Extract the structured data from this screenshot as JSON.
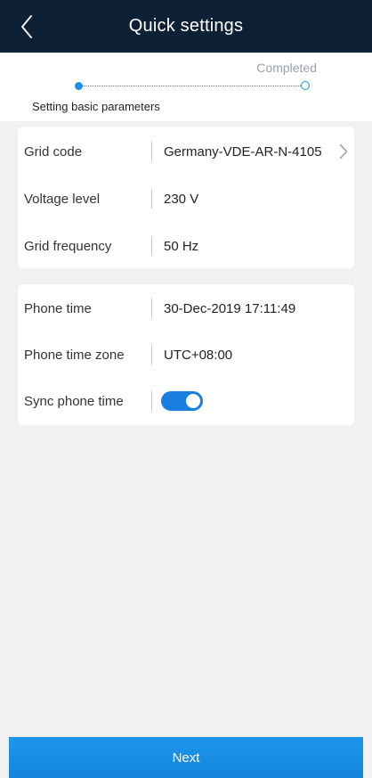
{
  "header": {
    "title": "Quick settings",
    "back_icon": "chevron-left-icon"
  },
  "steps": {
    "completed_label": "Completed",
    "current_label": "Setting basic parameters",
    "accent_color": "#1e90e8"
  },
  "grid_settings": {
    "rows": [
      {
        "label": "Grid code",
        "value": "Germany-VDE-AR-N-4105",
        "has_chevron": true
      },
      {
        "label": "Voltage level",
        "value": "230 V"
      },
      {
        "label": "Grid frequency",
        "value": "50 Hz"
      }
    ]
  },
  "time_settings": {
    "rows": [
      {
        "label": "Phone time",
        "value": "30-Dec-2019 17:11:49"
      },
      {
        "label": "Phone time zone",
        "value": "UTC+08:00"
      },
      {
        "label": "Sync phone time",
        "toggle_on": true
      }
    ]
  },
  "footer": {
    "next_label": "Next"
  },
  "colors": {
    "header_bg": "#0e2036",
    "toggle_on": "#1a7ee0",
    "button_bg": "#1a8de4"
  }
}
